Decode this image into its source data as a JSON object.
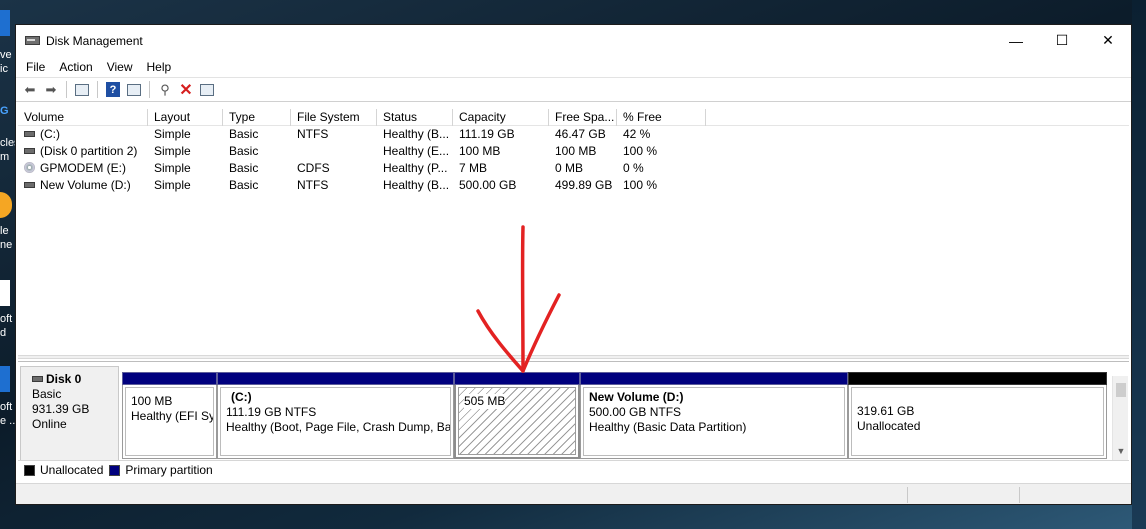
{
  "desktop": {
    "labels": [
      "ve",
      "ic",
      "cles",
      "m",
      "le",
      "ne",
      "oft",
      "d",
      "oft",
      "e .."
    ]
  },
  "window": {
    "title": "Disk Management",
    "controls": {
      "minimize": "—",
      "maximize": "☐",
      "close": "✕"
    }
  },
  "menu": [
    "File",
    "Action",
    "View",
    "Help"
  ],
  "volumes": {
    "columns": [
      "Volume",
      "Layout",
      "Type",
      "File System",
      "Status",
      "Capacity",
      "Free Spa...",
      "% Free"
    ],
    "rows": [
      {
        "icon": "volume-icon",
        "cells": [
          "(C:)",
          "Simple",
          "Basic",
          "NTFS",
          "Healthy (B...",
          "111.19 GB",
          "46.47 GB",
          "42 %"
        ]
      },
      {
        "icon": "volume-icon",
        "cells": [
          "(Disk 0 partition 2)",
          "Simple",
          "Basic",
          "",
          "Healthy (E...",
          "100 MB",
          "100 MB",
          "100 %"
        ]
      },
      {
        "icon": "cd-icon",
        "cells": [
          "GPMODEM (E:)",
          "Simple",
          "Basic",
          "CDFS",
          "Healthy (P...",
          "7 MB",
          "0 MB",
          "0 %"
        ]
      },
      {
        "icon": "volume-icon",
        "cells": [
          "New Volume (D:)",
          "Simple",
          "Basic",
          "NTFS",
          "Healthy (B...",
          "500.00 GB",
          "499.89 GB",
          "100 %"
        ]
      }
    ]
  },
  "disk": {
    "name": "Disk 0",
    "type": "Basic",
    "size": "931.39 GB",
    "state": "Online",
    "partitions": [
      {
        "title": "",
        "line1": "100 MB",
        "line2": "Healthy (EFI Sy",
        "kind": "primary"
      },
      {
        "title": "(C:)",
        "line1": "111.19 GB NTFS",
        "line2": "Healthy (Boot, Page File, Crash Dump, Bas",
        "kind": "primary"
      },
      {
        "title": "",
        "line1": "505 MB",
        "line2": "",
        "kind": "primary-hatched"
      },
      {
        "title": "New Volume  (D:)",
        "line1": "500.00 GB NTFS",
        "line2": "Healthy (Basic Data Partition)",
        "kind": "primary"
      },
      {
        "title": "",
        "line1": "319.61 GB",
        "line2": "Unallocated",
        "kind": "unallocated"
      }
    ]
  },
  "legend": {
    "unallocated": "Unallocated",
    "primary": "Primary partition",
    "colors": {
      "unallocated": "#000000",
      "primary": "#00007e"
    }
  },
  "annotation": {
    "icon": "red-down-arrow",
    "color": "#e32222"
  }
}
